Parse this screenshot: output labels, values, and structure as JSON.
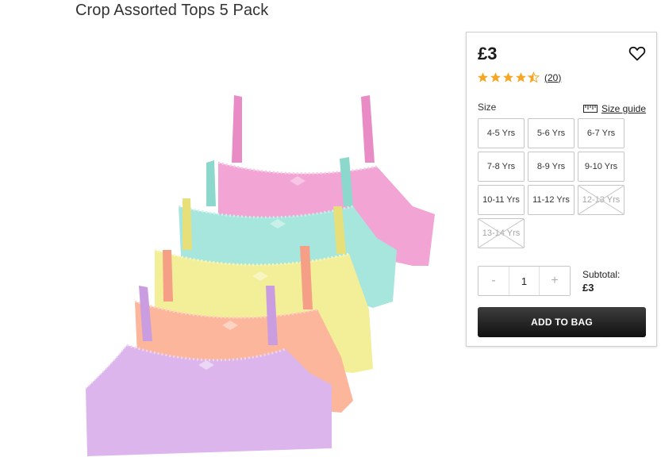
{
  "product": {
    "title": "Crop Assorted Tops 5 Pack",
    "image_alt": "Five pastel crop tops",
    "colors": [
      "#f2a4d4",
      "#a6e6dc",
      "#f3ef98",
      "#fcb69c",
      "#dcb5ec"
    ]
  },
  "panel": {
    "price": "£3",
    "wishlist_icon": "heart-outline-icon",
    "rating": {
      "stars": 4.5,
      "max": 5,
      "review_count": "20",
      "star_color": "#f5a623"
    },
    "size_label": "Size",
    "size_guide_label": "Size guide",
    "size_guide_icon": "ruler-icon",
    "sizes": [
      {
        "label": "4-5 Yrs",
        "available": true
      },
      {
        "label": "5-6 Yrs",
        "available": true
      },
      {
        "label": "6-7 Yrs",
        "available": true
      },
      {
        "label": "7-8 Yrs",
        "available": true
      },
      {
        "label": "8-9 Yrs",
        "available": true
      },
      {
        "label": "9-10 Yrs",
        "available": true
      },
      {
        "label": "10-11 Yrs",
        "available": true
      },
      {
        "label": "11-12 Yrs",
        "available": true
      },
      {
        "label": "12-13 Yrs",
        "available": false
      },
      {
        "label": "13-14 Yrs",
        "available": false
      }
    ],
    "quantity": {
      "minus_label": "-",
      "value": "1",
      "plus_label": "+"
    },
    "subtotal_label": "Subtotal:",
    "subtotal_value": "£3",
    "add_to_bag_label": "ADD TO BAG"
  }
}
